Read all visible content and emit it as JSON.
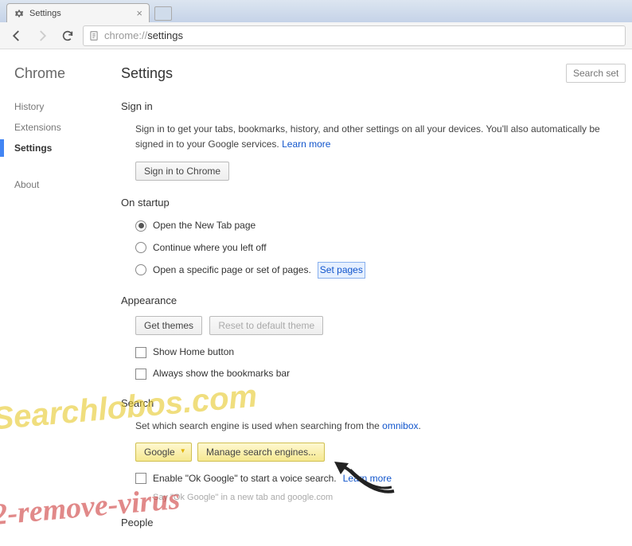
{
  "tab": {
    "title": "Settings",
    "icon": "gear-icon"
  },
  "address": {
    "prefix": "chrome://",
    "path": "settings"
  },
  "sidebar": {
    "title": "Chrome",
    "items": [
      {
        "label": "History",
        "active": false
      },
      {
        "label": "Extensions",
        "active": false
      },
      {
        "label": "Settings",
        "active": true
      }
    ],
    "about": "About"
  },
  "header": {
    "title": "Settings",
    "search_placeholder": "Search setting"
  },
  "signin": {
    "title": "Sign in",
    "text": "Sign in to get your tabs, bookmarks, history, and other settings on all your devices. You'll also automatically be signed in to your Google services. ",
    "learn_more": "Learn more",
    "button": "Sign in to Chrome"
  },
  "startup": {
    "title": "On startup",
    "options": [
      {
        "label": "Open the New Tab page",
        "checked": true
      },
      {
        "label": "Continue where you left off",
        "checked": false
      },
      {
        "label": "Open a specific page or set of pages. ",
        "checked": false
      }
    ],
    "set_pages": "Set pages"
  },
  "appearance": {
    "title": "Appearance",
    "get_themes": "Get themes",
    "reset_theme": "Reset to default theme",
    "show_home": "Show Home button",
    "show_bookmarks": "Always show the bookmarks bar"
  },
  "search": {
    "title": "Search",
    "text": "Set which search engine is used when searching from the ",
    "omnibox": "omnibox",
    "engine": "Google",
    "manage": "Manage search engines...",
    "enable_ok": "Enable \"Ok Google\" to start a voice search. ",
    "learn_more": "Learn more",
    "hint": "Say \"Ok Google\" in a new tab and google.com"
  },
  "people": {
    "title": "People"
  },
  "watermarks": {
    "w1": "Searchlobos.com",
    "w2": "2-remove-virus"
  }
}
